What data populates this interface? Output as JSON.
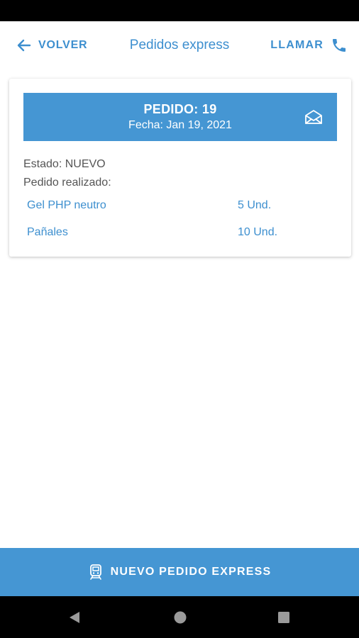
{
  "header": {
    "back_label": "VOLVER",
    "title": "Pedidos express",
    "call_label": "LLAMAR"
  },
  "order": {
    "number_text": "PEDIDO: 19",
    "date_text": "Fecha: Jan 19, 2021",
    "status_text": "Estado: NUEVO",
    "placed_label": "Pedido realizado:",
    "items": [
      {
        "name": "Gel PHP neutro",
        "qty": "5 Und."
      },
      {
        "name": "Pañales",
        "qty": "10 Und."
      }
    ]
  },
  "footer": {
    "new_order_label": "NUEVO PEDIDO EXPRESS"
  },
  "colors": {
    "accent": "#3d8fcf",
    "banner": "#4596d3",
    "text_gray": "#555555"
  },
  "icons": {
    "back": "arrow-left-icon",
    "call": "phone-icon",
    "mail": "envelope-open-icon",
    "new_order": "train-icon"
  }
}
